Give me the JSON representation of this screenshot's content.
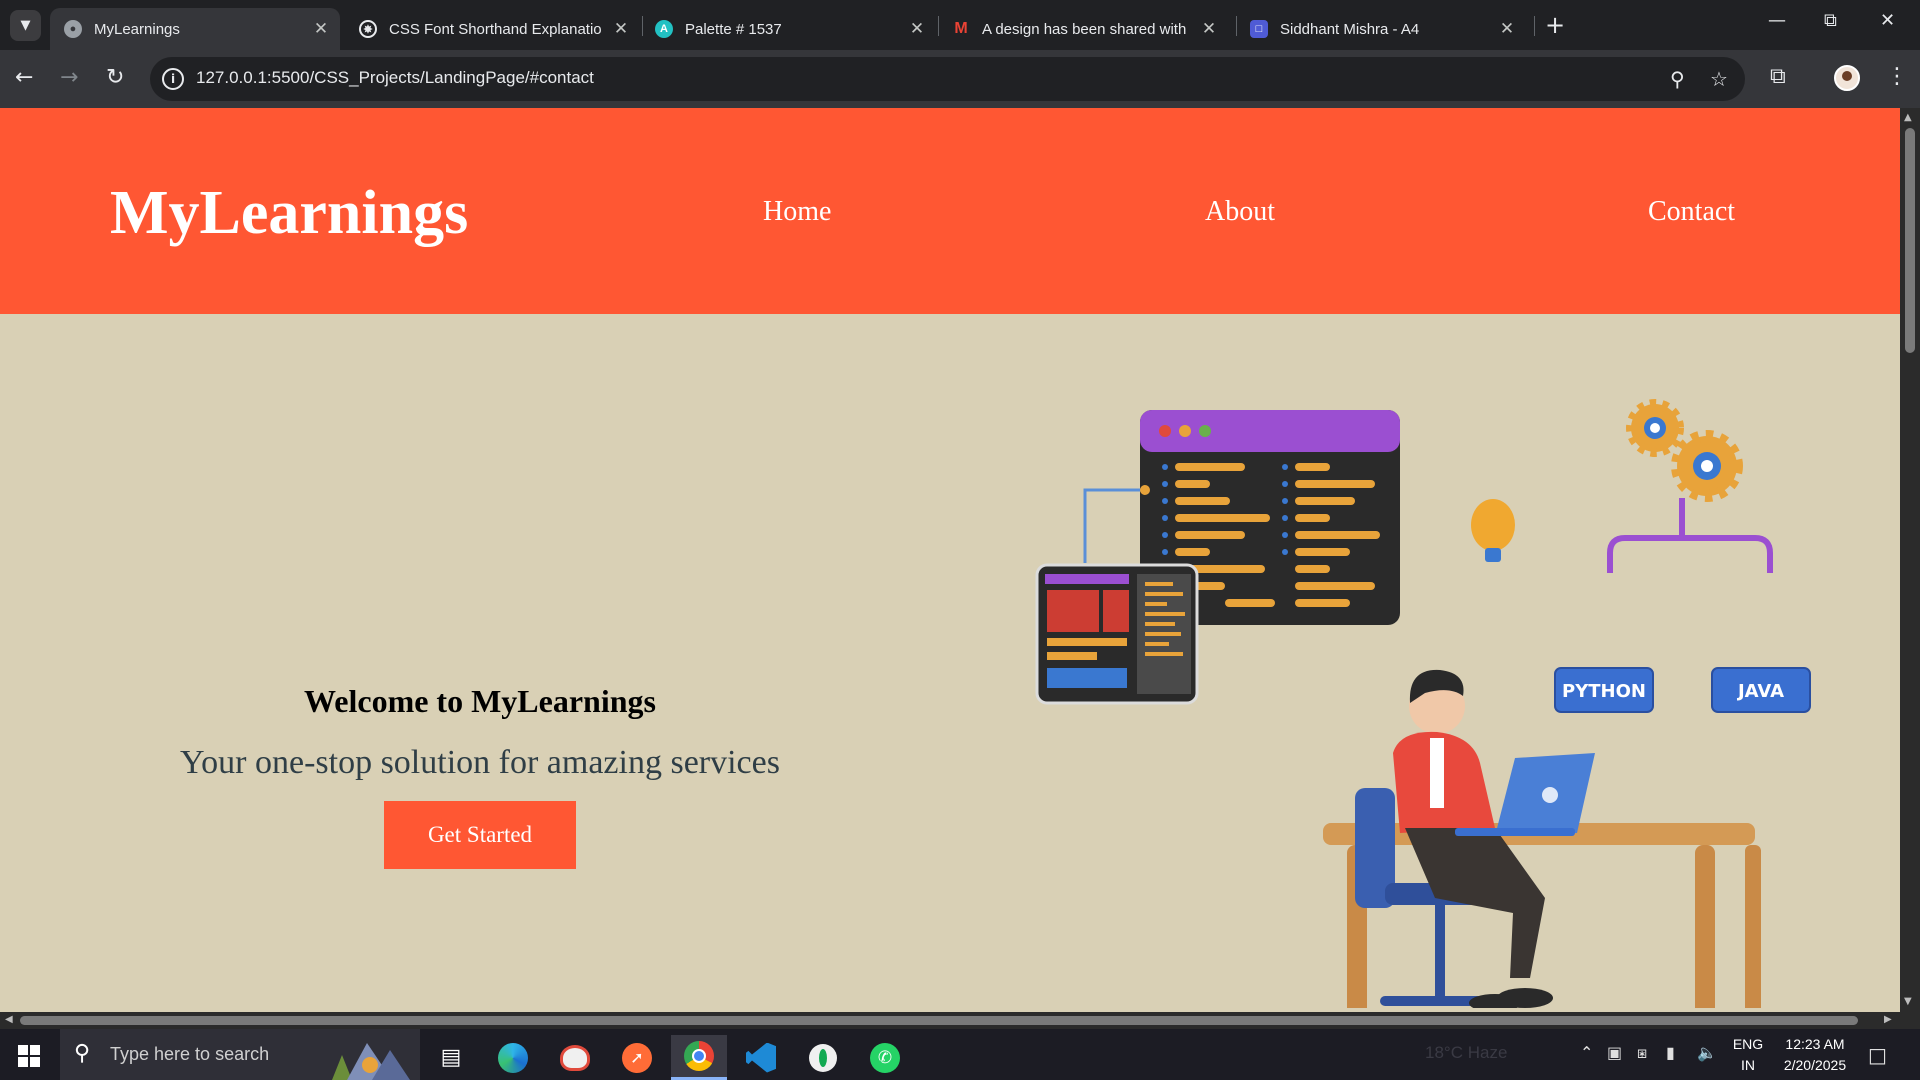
{
  "browser": {
    "tabs": [
      {
        "title": "MyLearnings",
        "icon": "globe-icon",
        "active": true
      },
      {
        "title": "CSS Font Shorthand Explanatio",
        "icon": "chatgpt-icon",
        "active": false
      },
      {
        "title": "Palette # 1537",
        "icon": "palette-app-icon",
        "active": false
      },
      {
        "title": "A design has been shared with",
        "icon": "gmail-icon",
        "active": false
      },
      {
        "title": "Siddhant Mishra - A4",
        "icon": "document-app-icon",
        "active": false
      }
    ],
    "url": "127.0.0.1:5500/CSS_Projects/LandingPage/#contact"
  },
  "site": {
    "logo": "MyLearnings",
    "nav": {
      "home": "Home",
      "about": "About",
      "contact": "Contact"
    },
    "hero": {
      "title": "Welcome to MyLearnings",
      "subtitle": "Your one-stop solution for amazing services",
      "cta": "Get Started"
    },
    "illustration": {
      "tags": [
        "PYTHON",
        "JAVA"
      ]
    },
    "colors": {
      "brand": "#ff5733",
      "background": "#d9d0b5"
    }
  },
  "taskbar": {
    "search_placeholder": "Type here to search",
    "weather": "18°C  Haze",
    "lang": "ENG",
    "region": "IN",
    "time": "12:23 AM",
    "date": "2/20/2025"
  }
}
